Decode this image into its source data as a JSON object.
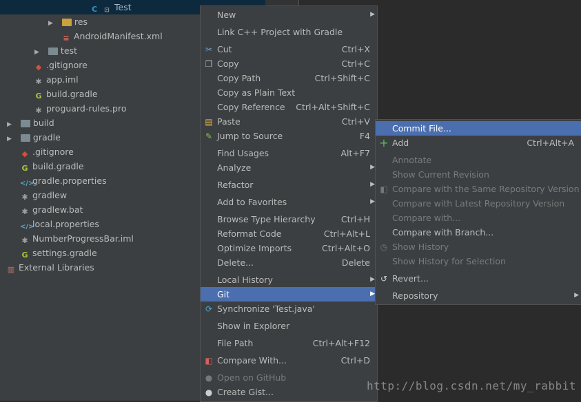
{
  "tree": {
    "selected": "Test",
    "items": [
      {
        "label": "Test",
        "icon": "java-class-icon"
      },
      {
        "label": "res",
        "icon": "res-folder-icon"
      },
      {
        "label": "AndroidManifest.xml",
        "icon": "xml-file-icon"
      },
      {
        "label": "test",
        "icon": "folder-icon"
      },
      {
        "label": ".gitignore",
        "icon": "gitignore-icon"
      },
      {
        "label": "app.iml",
        "icon": "iml-file-icon"
      },
      {
        "label": "build.gradle",
        "icon": "gradle-icon"
      },
      {
        "label": "proguard-rules.pro",
        "icon": "file-icon"
      },
      {
        "label": "build",
        "icon": "folder-icon"
      },
      {
        "label": "gradle",
        "icon": "folder-icon"
      },
      {
        "label": ".gitignore",
        "icon": "gitignore-icon"
      },
      {
        "label": "build.gradle",
        "icon": "gradle-icon"
      },
      {
        "label": "gradle.properties",
        "icon": "properties-icon"
      },
      {
        "label": "gradlew",
        "icon": "file-icon"
      },
      {
        "label": "gradlew.bat",
        "icon": "file-icon"
      },
      {
        "label": "local.properties",
        "icon": "properties-icon"
      },
      {
        "label": "NumberProgressBar.iml",
        "icon": "iml-file-icon"
      },
      {
        "label": "settings.gradle",
        "icon": "gradle-icon"
      },
      {
        "label": "External Libraries",
        "icon": "library-icon"
      }
    ]
  },
  "context_menu": {
    "items": [
      {
        "label": "New",
        "shortcut": "",
        "submenu": true
      },
      {
        "label": "Link C++ Project with Gradle",
        "shortcut": ""
      },
      {
        "label": "Cut",
        "shortcut": "Ctrl+X",
        "icon": "scissors-icon"
      },
      {
        "label": "Copy",
        "shortcut": "Ctrl+C",
        "icon": "copy-icon"
      },
      {
        "label": "Copy Path",
        "shortcut": "Ctrl+Shift+C"
      },
      {
        "label": "Copy as Plain Text",
        "shortcut": ""
      },
      {
        "label": "Copy Reference",
        "shortcut": "Ctrl+Alt+Shift+C"
      },
      {
        "label": "Paste",
        "shortcut": "Ctrl+V",
        "icon": "paste-icon"
      },
      {
        "label": "Jump to Source",
        "shortcut": "F4",
        "icon": "edit-icon"
      },
      {
        "label": "Find Usages",
        "shortcut": "Alt+F7"
      },
      {
        "label": "Analyze",
        "shortcut": "",
        "submenu": true
      },
      {
        "label": "Refactor",
        "shortcut": "",
        "submenu": true
      },
      {
        "label": "Add to Favorites",
        "shortcut": "",
        "submenu": true
      },
      {
        "label": "Browse Type Hierarchy",
        "shortcut": "Ctrl+H"
      },
      {
        "label": "Reformat Code",
        "shortcut": "Ctrl+Alt+L"
      },
      {
        "label": "Optimize Imports",
        "shortcut": "Ctrl+Alt+O"
      },
      {
        "label": "Delete...",
        "shortcut": "Delete"
      },
      {
        "label": "Local History",
        "shortcut": "",
        "submenu": true
      },
      {
        "label": "Git",
        "shortcut": "",
        "submenu": true,
        "highlighted": true
      },
      {
        "label": "Synchronize 'Test.java'",
        "shortcut": "",
        "icon": "sync-icon"
      },
      {
        "label": "Show in Explorer",
        "shortcut": ""
      },
      {
        "label": "File Path",
        "shortcut": "Ctrl+Alt+F12"
      },
      {
        "label": "Compare With...",
        "shortcut": "Ctrl+D",
        "icon": "compare-icon"
      },
      {
        "label": "Open on GitHub",
        "shortcut": "",
        "icon": "github-icon",
        "disabled": true
      },
      {
        "label": "Create Gist...",
        "shortcut": "",
        "icon": "github-icon"
      }
    ]
  },
  "git_submenu": {
    "items": [
      {
        "label": "Commit File...",
        "shortcut": "",
        "highlighted": true
      },
      {
        "label": "Add",
        "shortcut": "Ctrl+Alt+A",
        "icon": "plus-icon"
      },
      {
        "label": "Annotate",
        "shortcut": "",
        "disabled": true
      },
      {
        "label": "Show Current Revision",
        "shortcut": "",
        "disabled": true
      },
      {
        "label": "Compare with the Same Repository Version",
        "shortcut": "",
        "disabled": true,
        "icon": "compare-icon"
      },
      {
        "label": "Compare with Latest Repository Version",
        "shortcut": "",
        "disabled": true
      },
      {
        "label": "Compare with...",
        "shortcut": "",
        "disabled": true
      },
      {
        "label": "Compare with Branch...",
        "shortcut": ""
      },
      {
        "label": "Show History",
        "shortcut": "",
        "disabled": true,
        "icon": "history-icon"
      },
      {
        "label": "Show History for Selection",
        "shortcut": "",
        "disabled": true
      },
      {
        "label": "Revert...",
        "shortcut": "",
        "icon": "revert-icon"
      },
      {
        "label": "Repository",
        "shortcut": "",
        "submenu": true
      }
    ]
  },
  "watermark": "http://blog.csdn.net/my_rabbit"
}
